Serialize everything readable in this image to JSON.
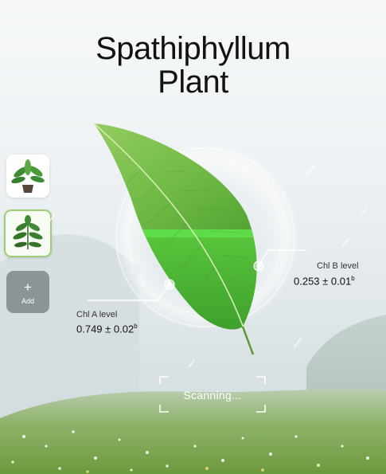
{
  "title": {
    "line1": "Spathiphyllum",
    "line2": "Plant"
  },
  "sidebar": {
    "thumbnails": [
      {
        "name": "spathiphyllum-thumbnail",
        "selected": false
      },
      {
        "name": "leafy-plant-thumbnail",
        "selected": true
      }
    ],
    "add": {
      "icon": "+",
      "label": "Add"
    }
  },
  "metrics": {
    "chl_b": {
      "label": "Chl B level",
      "value": "0.253 ± 0.01",
      "superscript": "b"
    },
    "chl_a": {
      "label": "Chl A level",
      "value": "0.749 ± 0.02",
      "superscript": "b"
    }
  },
  "scan": {
    "status": "Scanning..."
  },
  "colors": {
    "leaf_light": "#7cc84a",
    "leaf_dark": "#3f9a2a",
    "scan_band": "#5ee14a",
    "selected_border": "#9fcf75",
    "add_button": "#8c9595"
  }
}
